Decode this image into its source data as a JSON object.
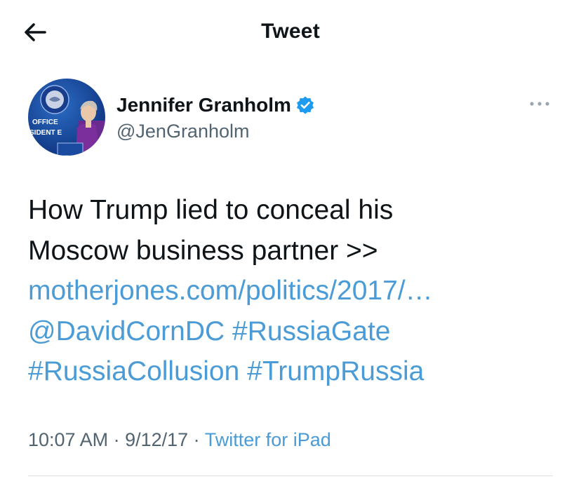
{
  "header": {
    "title": "Tweet",
    "back_icon": "arrow-left-icon"
  },
  "author": {
    "display_name": "Jennifer Granholm",
    "handle": "@JenGranholm",
    "verified_icon": "verified-badge-icon",
    "more_icon": "more-horizontal-icon",
    "avatar_sign_lines": [
      "OFFICE",
      "SIDENT E"
    ]
  },
  "tweet": {
    "line1": "How Trump lied to conceal his",
    "line2": "Moscow business partner >>",
    "link_url": "motherjones.com/politics/2017/…",
    "mention": "@DavidCornDC",
    "hashtag1": "#RussiaGate",
    "hashtag2": "#RussiaCollusion",
    "hashtag3": "#TrumpRussia"
  },
  "meta": {
    "time": "10:07 AM",
    "sep1": " · ",
    "date": "9/12/17",
    "sep2": " · ",
    "source": "Twitter for iPad"
  },
  "colors": {
    "link": "#4a9bd6",
    "verified": "#1d9bf0",
    "secondary_text": "#536471",
    "primary_text": "#0f1419"
  }
}
